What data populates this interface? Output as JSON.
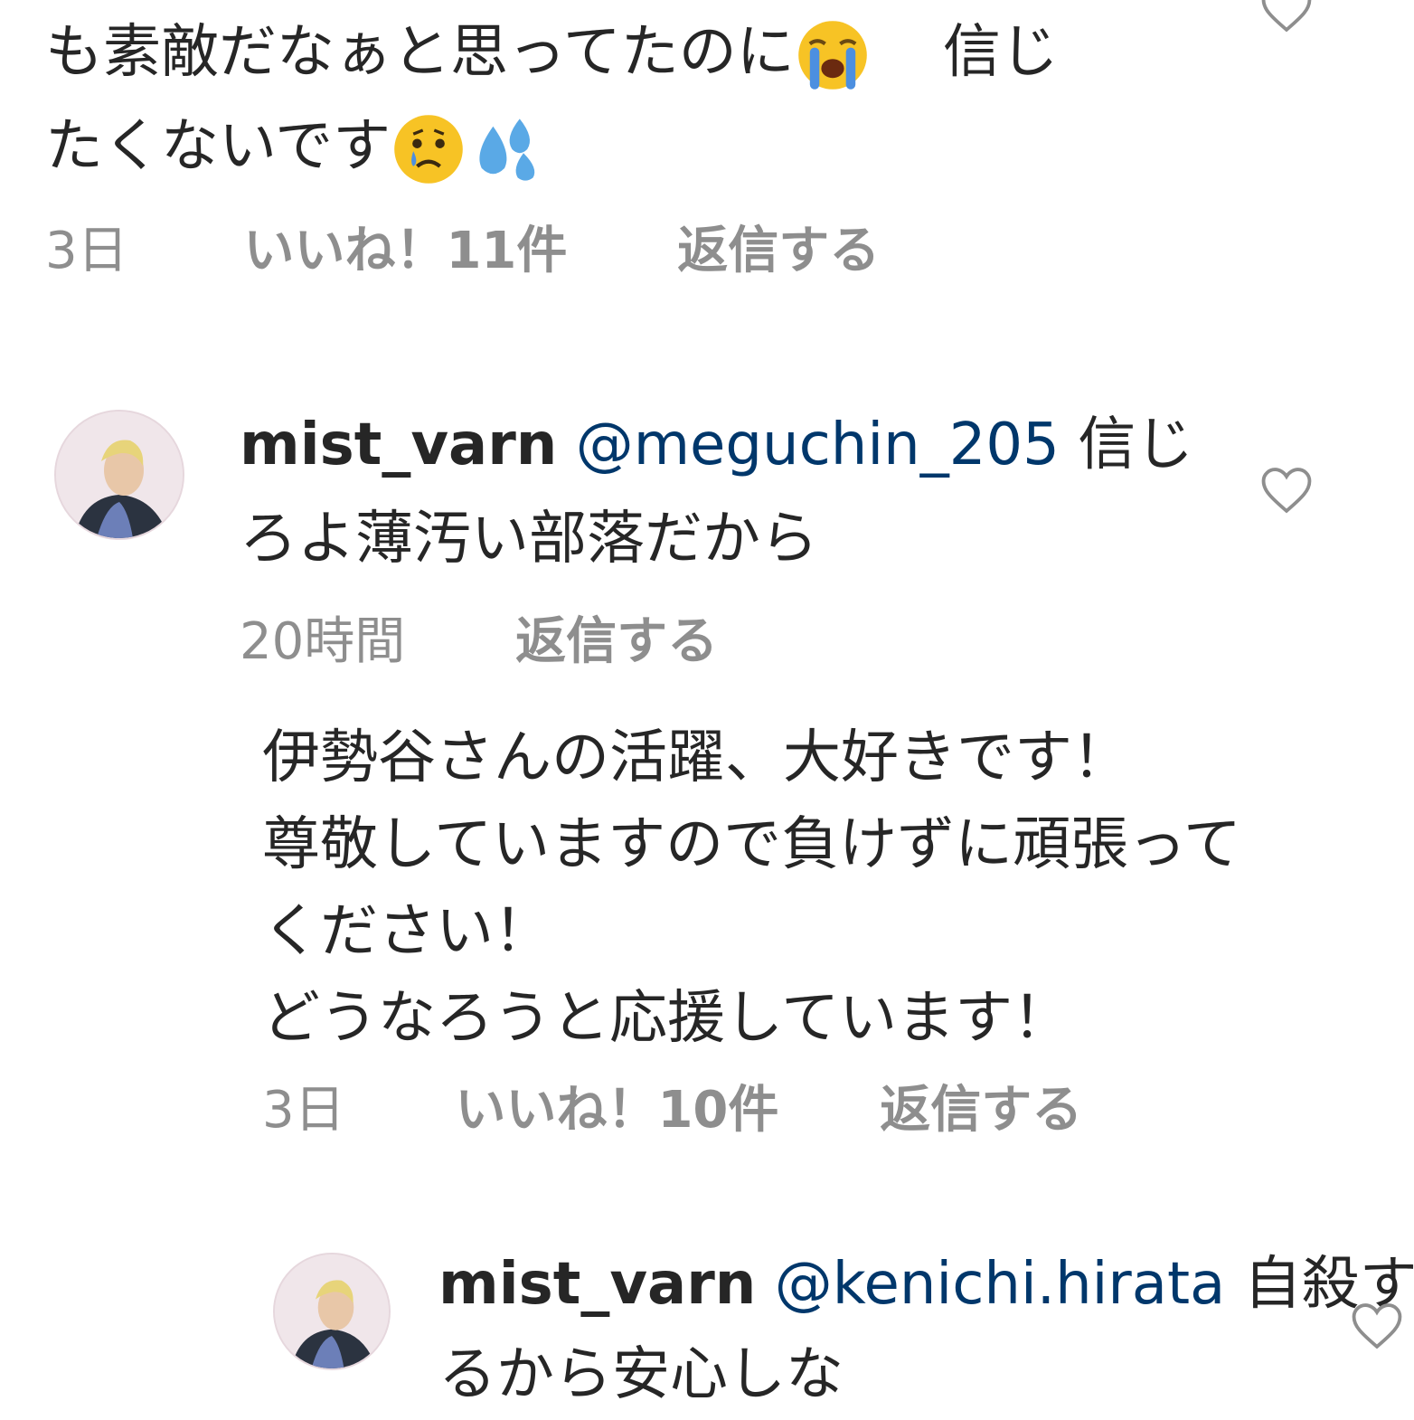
{
  "comment1": {
    "line1": "も素敵だなぁと思ってたのに",
    "line1_tail": "信じ",
    "line2": "たくないです",
    "emoji_icons": [
      "loudly-crying-face-icon",
      "crying-face-icon",
      "sweat-droplets-icon"
    ],
    "time": "3日",
    "likes": "いいね！11件",
    "reply": "返信する"
  },
  "comment2": {
    "username": "mist_varn",
    "mention": "@meguchin_205",
    "text_line1_tail": "信じ",
    "text_line2": "ろよ薄汚い部落だから",
    "time": "20時間",
    "reply": "返信する"
  },
  "comment3": {
    "line1": "伊勢谷さんの活躍、大好きです！",
    "line2": "尊敬していますので負けずに頑張って",
    "line3": "ください！",
    "line4": "どうなろうと応援しています！",
    "time": "3日",
    "likes": "いいね！10件",
    "reply": "返信する"
  },
  "comment4": {
    "username": "mist_varn",
    "mention": "@kenichi.hirata",
    "text_line1_tail": "自殺す",
    "text_line2": "るから安心しな"
  },
  "colors": {
    "text": "#262626",
    "meta": "#8e8e8e",
    "mention": "#00376b",
    "heart_stroke": "#8e8e8e"
  }
}
